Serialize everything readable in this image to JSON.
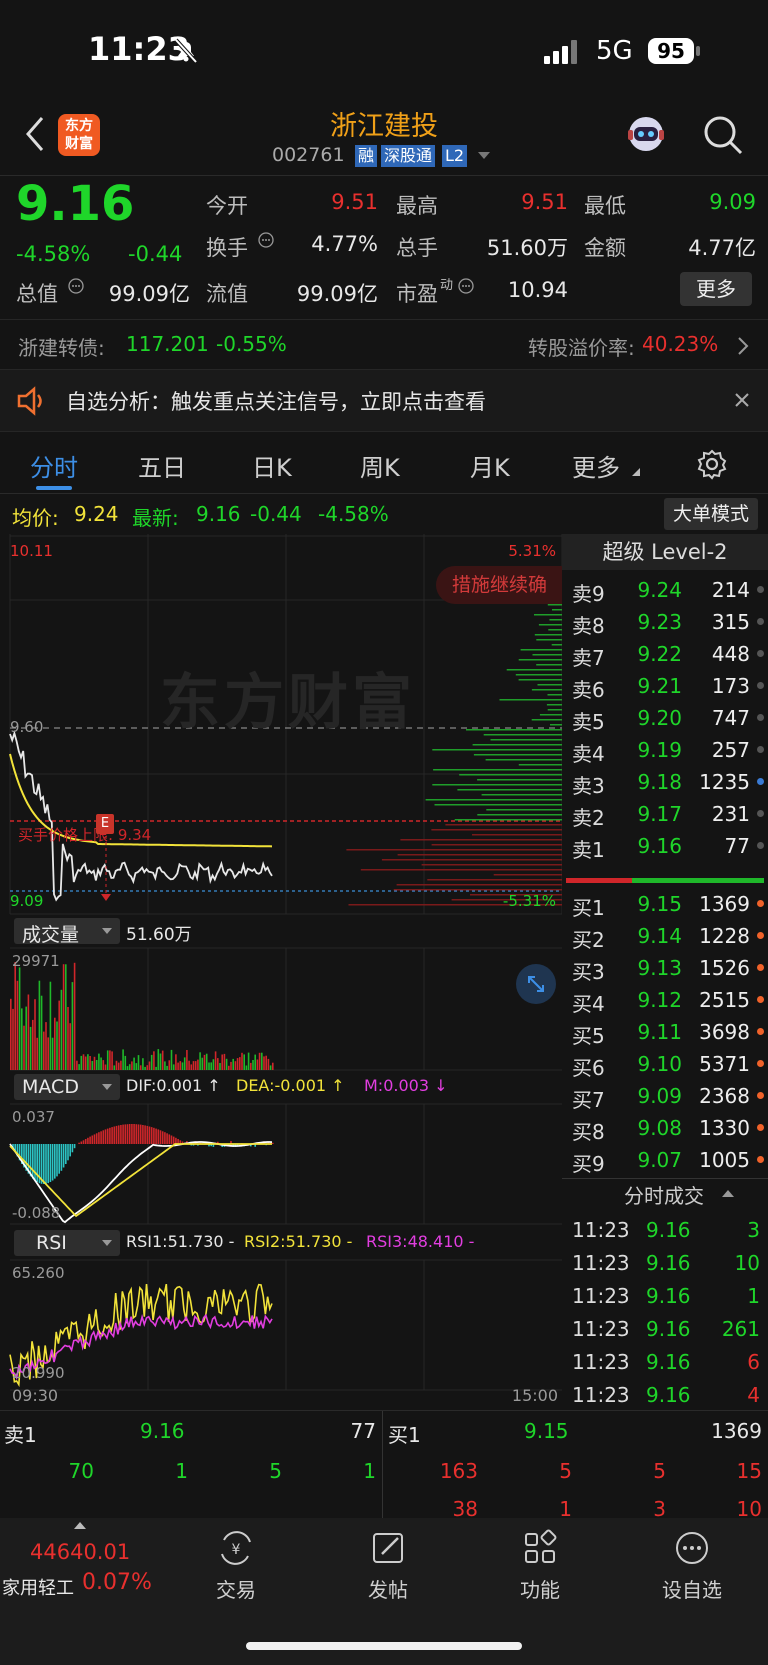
{
  "status": {
    "time": "11:23",
    "network": "5G",
    "battery": "95"
  },
  "nav": {
    "title": "浙江建投",
    "code": "002761",
    "badges": [
      "融",
      "深股通",
      "L2"
    ],
    "logo_text": "东方\n财富"
  },
  "quote": {
    "price": "9.16",
    "pct": "-4.58%",
    "chg": "-0.44",
    "rows": [
      {
        "l1": "今开",
        "v1": "9.51",
        "l2": "最高",
        "v2": "9.51",
        "l3": "最低",
        "v3": "9.09"
      },
      {
        "l1": "换手",
        "v1": "4.77%",
        "l2": "总手",
        "v2": "51.60万",
        "l3": "金额",
        "v3": "4.77亿"
      },
      {
        "l1": "总值",
        "v1": "99.09亿",
        "l2": "流值",
        "v2": "99.09亿",
        "l3": "市盈",
        "v3": "10.94"
      }
    ],
    "pe_sup": "动",
    "more": "更多"
  },
  "bond": {
    "name": "浙建转债:",
    "price": "117.201",
    "pct": "-0.55%",
    "premium_label": "转股溢价率:",
    "premium": "40.23%"
  },
  "notice": {
    "text": "自选分析：触发重点关注信号，立即点击查看"
  },
  "tabs": [
    "分时",
    "五日",
    "日K",
    "周K",
    "月K",
    "更多"
  ],
  "info": {
    "avg_label": "均价:",
    "avg": "9.24",
    "last_label": "最新:",
    "last": "9.16",
    "chg": "-0.44",
    "pct": "-4.58%",
    "mode": "大单模式"
  },
  "chart": {
    "price_high": "10.11",
    "price_mid": "9.60",
    "price_low": "9.09",
    "pct_high": "5.31%",
    "pct_low": "-5.31%",
    "warning": "措施继续确",
    "prev_label": "买手价格上限: 9.34",
    "marker": "E",
    "watermark": "东方财富",
    "vol_label": "成交量",
    "vol_value": "51.60万",
    "vol_max": "29971",
    "macd_label": "MACD",
    "dif": "DIF:0.001 ↑",
    "dea": "DEA:-0.001 ↑",
    "mval": "M:0.003 ↓",
    "macd_high": "0.037",
    "macd_low": "-0.088",
    "rsi_label": "RSI",
    "rsi1": "RSI1:51.730 -",
    "rsi2": "RSI2:51.730 -",
    "rsi3": "RSI3:48.410 -",
    "rsi_high": "65.260",
    "rsi_low": "20.990",
    "time_start": "09:30",
    "time_end": "15:00"
  },
  "book": {
    "title": "超级 Level-2",
    "sells": [
      {
        "l": "卖9",
        "p": "9.24",
        "v": "214",
        "dot": "#555"
      },
      {
        "l": "卖8",
        "p": "9.23",
        "v": "315",
        "dot": "#555"
      },
      {
        "l": "卖7",
        "p": "9.22",
        "v": "448",
        "dot": "#555"
      },
      {
        "l": "卖6",
        "p": "9.21",
        "v": "173",
        "dot": "#555"
      },
      {
        "l": "卖5",
        "p": "9.20",
        "v": "747",
        "dot": "#555"
      },
      {
        "l": "卖4",
        "p": "9.19",
        "v": "257",
        "dot": "#555"
      },
      {
        "l": "卖3",
        "p": "9.18",
        "v": "1235",
        "dot": "#3a7bd5"
      },
      {
        "l": "卖2",
        "p": "9.17",
        "v": "231",
        "dot": "#555"
      },
      {
        "l": "卖1",
        "p": "9.16",
        "v": "77",
        "dot": "#555"
      }
    ],
    "buys": [
      {
        "l": "买1",
        "p": "9.15",
        "v": "1369"
      },
      {
        "l": "买2",
        "p": "9.14",
        "v": "1228"
      },
      {
        "l": "买3",
        "p": "9.13",
        "v": "1526"
      },
      {
        "l": "买4",
        "p": "9.12",
        "v": "2515"
      },
      {
        "l": "买5",
        "p": "9.11",
        "v": "3698"
      },
      {
        "l": "买6",
        "p": "9.10",
        "v": "5371"
      },
      {
        "l": "买7",
        "p": "9.09",
        "v": "2368"
      },
      {
        "l": "买8",
        "p": "9.08",
        "v": "1330"
      },
      {
        "l": "买9",
        "p": "9.07",
        "v": "1005"
      }
    ],
    "trades_title": "分时成交",
    "trades": [
      {
        "t": "11:23",
        "p": "9.16",
        "v": "3",
        "c": "g"
      },
      {
        "t": "11:23",
        "p": "9.16",
        "v": "10",
        "c": "g"
      },
      {
        "t": "11:23",
        "p": "9.16",
        "v": "1",
        "c": "g"
      },
      {
        "t": "11:23",
        "p": "9.16",
        "v": "261",
        "c": "g"
      },
      {
        "t": "11:23",
        "p": "9.16",
        "v": "6",
        "c": "r"
      },
      {
        "t": "11:23",
        "p": "9.16",
        "v": "4",
        "c": "r"
      }
    ]
  },
  "bottomq": {
    "sell_label": "卖1",
    "sell_price": "9.16",
    "sell_vol": "77",
    "buy_label": "买1",
    "buy_price": "9.15",
    "buy_vol": "1369",
    "sell_q": [
      "70",
      "1",
      "5",
      "1"
    ],
    "buy_q1": [
      "163",
      "5",
      "5",
      "15"
    ],
    "buy_q2": [
      "38",
      "1",
      "3",
      "10"
    ]
  },
  "bottomnav": {
    "index_value": "44640.01",
    "index_name": "家用轻工",
    "index_pct": "0.07%",
    "items": [
      "交易",
      "发帖",
      "功能",
      "设自选"
    ]
  }
}
